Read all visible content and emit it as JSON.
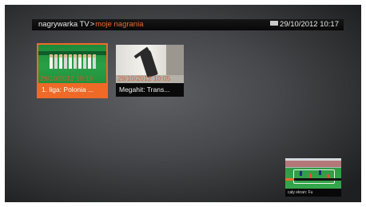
{
  "header": {
    "root": "nagrywarka TV",
    "separator": ">",
    "current": "moje nagrania",
    "datetime": "29/10/2012 10:17",
    "message_icon": "envelope-icon"
  },
  "recordings": [
    {
      "title": "1. liga: Polonia ...",
      "timestamp": "29/10/2012 10:16",
      "selected": true
    },
    {
      "title": "Megahit: Trans...",
      "timestamp": "29/10/2012 10:05",
      "selected": false
    }
  ],
  "preview": {
    "caption": "cały ekran: Fu",
    "progress": 0.16
  },
  "colors": {
    "accent": "#ef6a27",
    "background": "#46484b",
    "header_bg": "#0a0a0a",
    "text": "#e9e9e9"
  }
}
